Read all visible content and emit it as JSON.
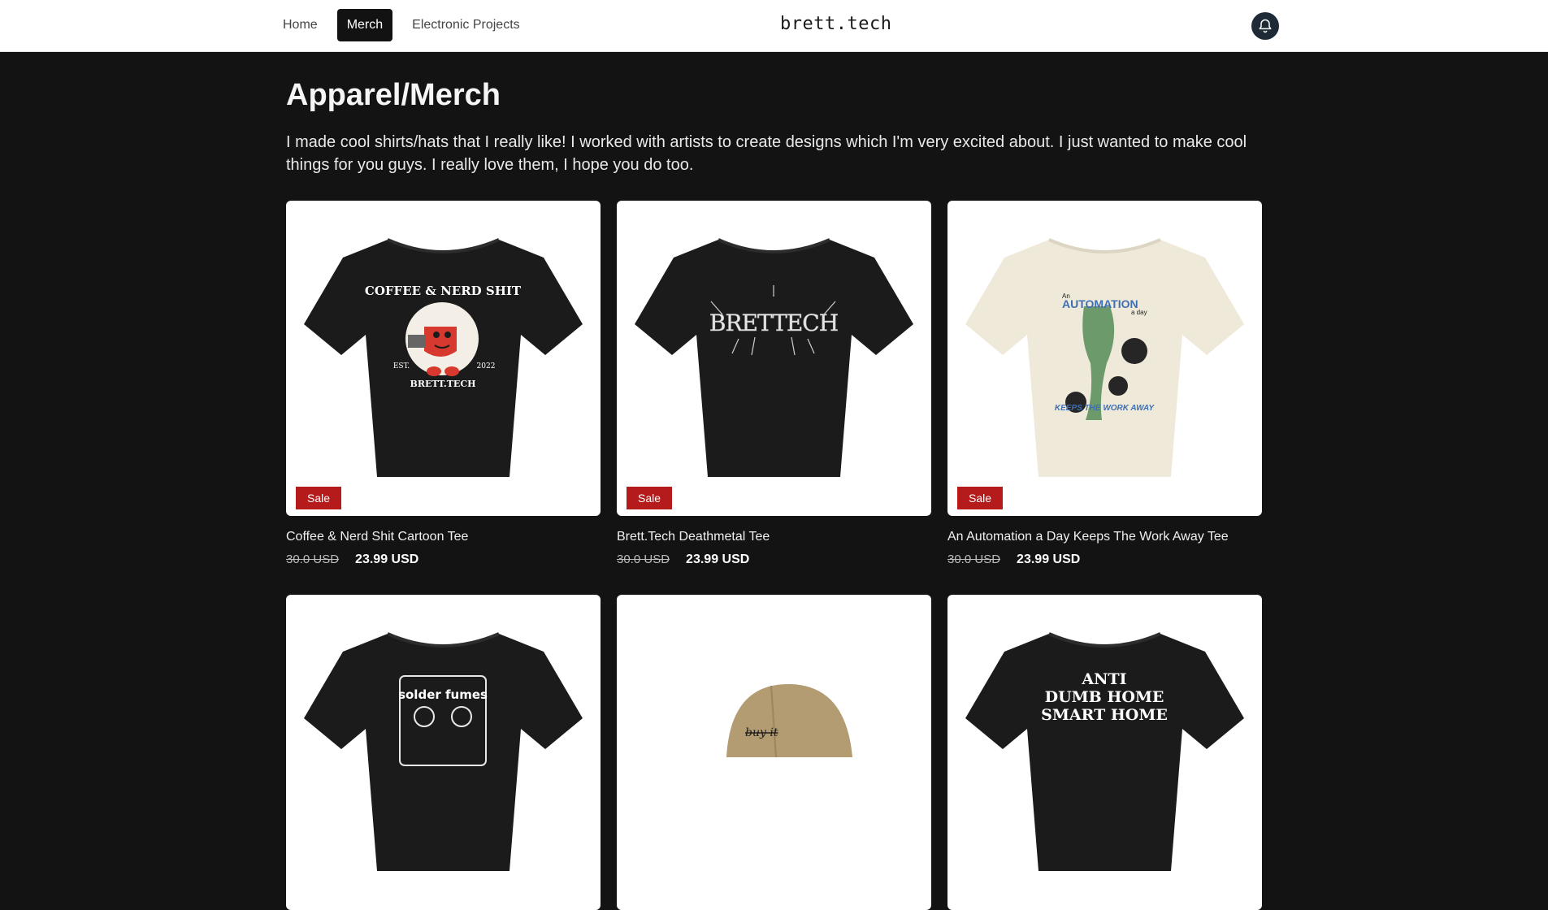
{
  "nav": {
    "items": [
      {
        "label": "Home"
      },
      {
        "label": "Merch"
      },
      {
        "label": "Electronic Projects"
      }
    ],
    "brand": "brett.tech"
  },
  "page": {
    "title": "Apparel/Merch",
    "intro": "I made cool shirts/hats that I really like! I worked with artists to create designs which I'm very excited about. I just wanted to make cool things for you guys. I really love them, I hope you do too."
  },
  "products": [
    {
      "name": "Coffee & Nerd Shit Cartoon Tee",
      "old_price": "30.0 USD",
      "price": "23.99 USD",
      "badge": "Sale",
      "shirt_color": "#1b1b1b",
      "print": {
        "top": "COFFEE & NERD SHIT",
        "left": "EST.",
        "right": "2022",
        "bottom": "BRETT.TECH"
      }
    },
    {
      "name": "Brett.Tech Deathmetal Tee",
      "old_price": "30.0 USD",
      "price": "23.99 USD",
      "badge": "Sale",
      "shirt_color": "#1b1b1b",
      "print": {
        "logo": "BRETTECH"
      }
    },
    {
      "name": "An Automation a Day Keeps The Work Away Tee",
      "old_price": "30.0 USD",
      "price": "23.99 USD",
      "badge": "Sale",
      "shirt_color": "#efe9da",
      "print": {
        "line1": "An",
        "line2": "AUTOMATION",
        "line3": "a day",
        "line4": "KEEPS THE WORK AWAY"
      }
    },
    {
      "name": "",
      "shirt_color": "#1b1b1b",
      "print": {
        "text": "solder fumes"
      }
    },
    {
      "name": "",
      "shirt_color": "#b39b72",
      "print": {
        "text": "buy it"
      }
    },
    {
      "name": "",
      "shirt_color": "#1b1b1b",
      "print": {
        "line1": "ANTI",
        "line2": "DUMB HOME",
        "line3": "SMART HOME"
      }
    }
  ]
}
